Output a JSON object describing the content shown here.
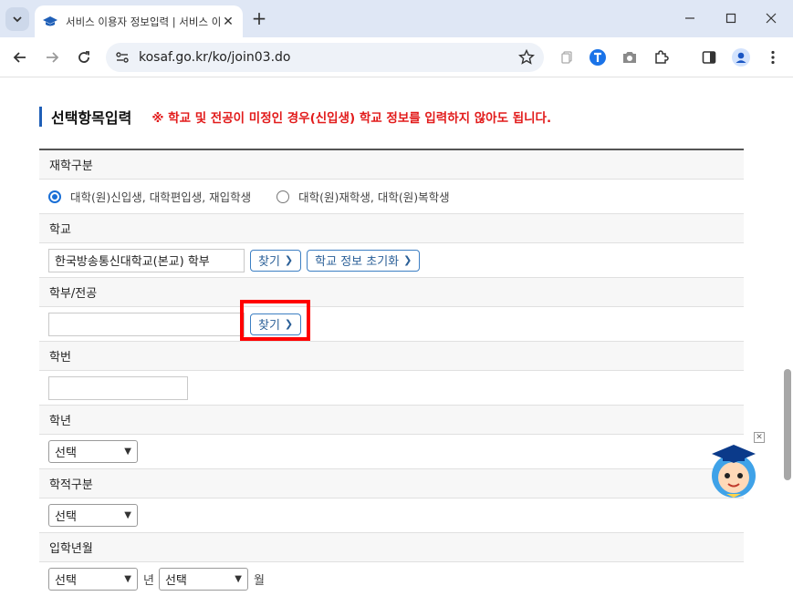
{
  "browser": {
    "tab_title": "서비스 이용자 정보입력 | 서비스 이용",
    "url": "kosaf.go.kr/ko/join03.do"
  },
  "section": {
    "title": "선택항목입력",
    "notice": "※ 학교 및 전공이 미정인 경우(신입생) 학교 정보를 입력하지 않아도 됩니다."
  },
  "form": {
    "enrollment_type": {
      "label": "재학구분",
      "options": [
        {
          "label": "대학(원)신입생, 대학편입생, 재입학생",
          "selected": true
        },
        {
          "label": "대학(원)재학생, 대학(원)복학생",
          "selected": false
        }
      ]
    },
    "school": {
      "label": "학교",
      "value": "한국방송통신대학교(본교) 학부",
      "find_label": "찾기",
      "reset_label": "학교 정보 초기화"
    },
    "department": {
      "label": "학부/전공",
      "value": "",
      "find_label": "찾기"
    },
    "student_id": {
      "label": "학번",
      "value": ""
    },
    "grade": {
      "label": "학년",
      "selected": "선택"
    },
    "status": {
      "label": "학적구분",
      "selected": "선택"
    },
    "admission": {
      "label": "입학년월",
      "year_selected": "선택",
      "year_unit": "년",
      "month_selected": "선택",
      "month_unit": "월"
    }
  },
  "colors": {
    "accent": "#1f5fb7",
    "notice": "#e21b1b",
    "button_border": "#3d7fc3",
    "highlight": "#ff0000"
  }
}
